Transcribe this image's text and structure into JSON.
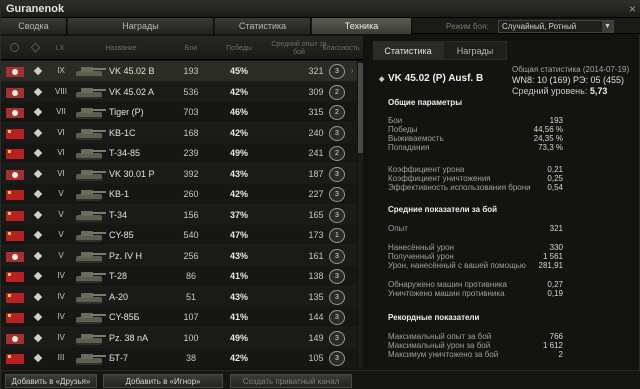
{
  "window": {
    "title": "Guranenok",
    "close": "×"
  },
  "tabs": [
    {
      "label": "Сводка",
      "active": false
    },
    {
      "label": "Награды",
      "active": false
    },
    {
      "label": "Статистика",
      "active": false
    },
    {
      "label": "Техника",
      "active": true
    }
  ],
  "battle_mode": {
    "label": "Режим боя:",
    "value": "Случайный, Ротный",
    "arrow": "▼"
  },
  "table_headers": {
    "tier": "LX",
    "name": "Название",
    "battles": "Бои",
    "wins": "Победы",
    "avg_xp": "Средний опыт за бой",
    "mastery": "Классность"
  },
  "vehicles": [
    {
      "nation": "de",
      "tier": "IX",
      "name": "VK 45.02 B",
      "battles": "193",
      "wins": "45%",
      "avg_xp": "321",
      "mastery": "3",
      "selected": true
    },
    {
      "nation": "de",
      "tier": "VIII",
      "name": "VK 45.02 A",
      "battles": "536",
      "wins": "42%",
      "avg_xp": "309",
      "mastery": "2"
    },
    {
      "nation": "de",
      "tier": "VII",
      "name": "Tiger (P)",
      "battles": "703",
      "wins": "46%",
      "avg_xp": "315",
      "mastery": "2"
    },
    {
      "nation": "ussr",
      "tier": "VI",
      "name": "KB-1C",
      "battles": "168",
      "wins": "42%",
      "avg_xp": "240",
      "mastery": "3"
    },
    {
      "nation": "ussr",
      "tier": "VI",
      "name": "T-34-85",
      "battles": "239",
      "wins": "49%",
      "avg_xp": "241",
      "mastery": "2"
    },
    {
      "nation": "de",
      "tier": "VI",
      "name": "VK 30.01 P",
      "battles": "392",
      "wins": "43%",
      "avg_xp": "187",
      "mastery": "3"
    },
    {
      "nation": "ussr",
      "tier": "V",
      "name": "KB-1",
      "battles": "260",
      "wins": "42%",
      "avg_xp": "227",
      "mastery": "3"
    },
    {
      "nation": "ussr",
      "tier": "V",
      "name": "T-34",
      "battles": "156",
      "wins": "37%",
      "avg_xp": "165",
      "mastery": "3"
    },
    {
      "nation": "ussr",
      "tier": "V",
      "name": "CY-85",
      "battles": "540",
      "wins": "47%",
      "avg_xp": "173",
      "mastery": "1"
    },
    {
      "nation": "de",
      "tier": "V",
      "name": "Pz. IV H",
      "battles": "256",
      "wins": "43%",
      "avg_xp": "161",
      "mastery": "3"
    },
    {
      "nation": "ussr",
      "tier": "IV",
      "name": "T-28",
      "battles": "86",
      "wins": "41%",
      "avg_xp": "138",
      "mastery": "3"
    },
    {
      "nation": "ussr",
      "tier": "IV",
      "name": "A-20",
      "battles": "51",
      "wins": "43%",
      "avg_xp": "135",
      "mastery": "3"
    },
    {
      "nation": "ussr",
      "tier": "IV",
      "name": "CY-85Б",
      "battles": "107",
      "wins": "41%",
      "avg_xp": "144",
      "mastery": "3"
    },
    {
      "nation": "de",
      "tier": "IV",
      "name": "Pz. 38 nA",
      "battles": "100",
      "wins": "49%",
      "avg_xp": "149",
      "mastery": "3"
    },
    {
      "nation": "ussr",
      "tier": "III",
      "name": "БТ-7",
      "battles": "38",
      "wins": "42%",
      "avg_xp": "105",
      "mastery": "3"
    }
  ],
  "panel": {
    "tabs": [
      {
        "label": "Статистика",
        "active": true
      },
      {
        "label": "Награды",
        "active": false
      }
    ],
    "vehicle_name": "VK 45.02 (P) Ausf. B",
    "general": "Общая статистика (2014-07-19)",
    "wn8": "WN8: 10 (169) РЭ: 05 (455)",
    "avg_level_label": "Средний уровень:",
    "avg_level_value": "5,73",
    "sections": {
      "general": "Общие параметры",
      "per_battle": "Средние показатели за бой",
      "records": "Рекордные показатели"
    },
    "stats": {
      "battles": {
        "label": "Бои",
        "value": "193"
      },
      "wins": {
        "label": "Победы",
        "value": "44,56 %"
      },
      "survival": {
        "label": "Выживаемость",
        "value": "24,35 %"
      },
      "hits": {
        "label": "Попадания",
        "value": "73,3 %"
      },
      "dmg_ratio": {
        "label": "Коэффициент урона",
        "value": "0,21"
      },
      "kill_ratio": {
        "label": "Коэффициент уничтожения",
        "value": "0,25"
      },
      "armor_eff": {
        "label": "Эффективность использования брони",
        "value": "0,54"
      },
      "xp": {
        "label": "Опыт",
        "value": "321"
      },
      "dmg_dealt": {
        "label": "Нанесённый урон",
        "value": "330"
      },
      "dmg_received": {
        "label": "Полученный урон",
        "value": "1 561"
      },
      "assist": {
        "label": "Урон, нанесённый с вашей помощью",
        "value": "281,91"
      },
      "spotted": {
        "label": "Обнаружено машин противника",
        "value": "0,27"
      },
      "destroyed": {
        "label": "Уничтожено машин противника",
        "value": "0,19"
      },
      "max_xp": {
        "label": "Максимальный опыт за бой",
        "value": "766"
      },
      "max_dmg": {
        "label": "Максимальный урон за бой",
        "value": "1 612"
      },
      "max_kills": {
        "label": "Максимум уничтожено за бой",
        "value": "2"
      }
    }
  },
  "bottom": {
    "add_friends": "Добавить в «Друзья»",
    "add_ignore": "Добавить в «Игнор»",
    "create_channel": "Создать приватный канал"
  }
}
